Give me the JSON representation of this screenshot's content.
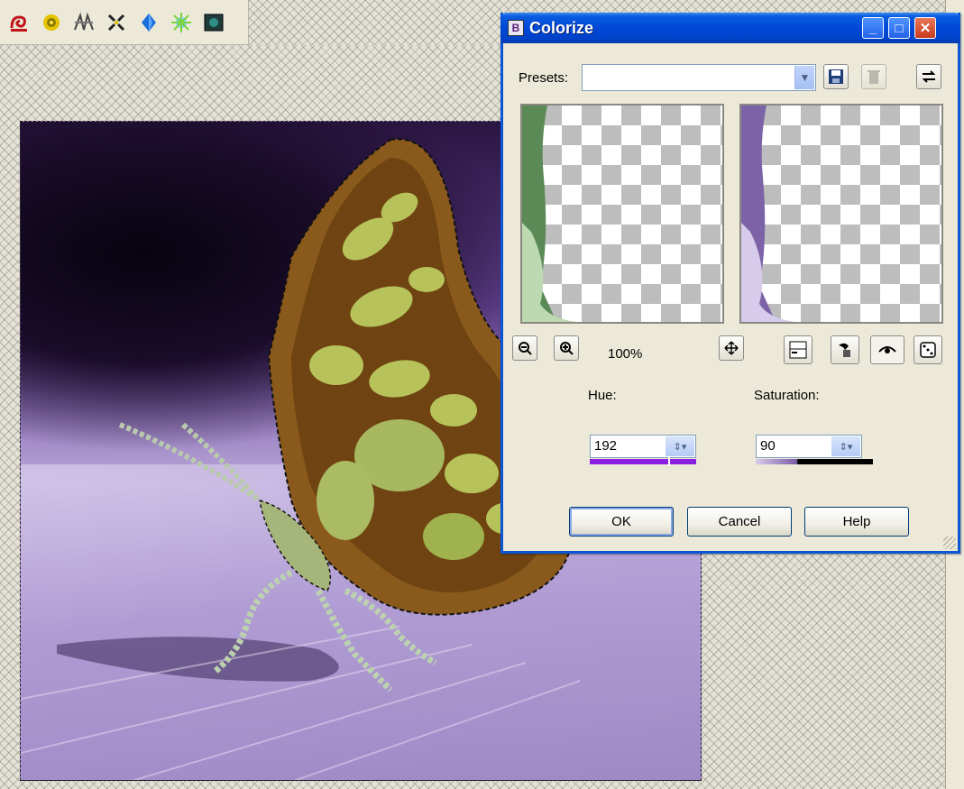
{
  "toolbar": {
    "icons": [
      "red-swirl-icon",
      "yellow-ring-icon",
      "pattern-icon",
      "sparkle-icon",
      "blue-gem-icon",
      "starburst-icon",
      "dark-frame-icon"
    ]
  },
  "dialog": {
    "title": "Colorize",
    "title_icon_letter": "B",
    "minimize_glyph": "_",
    "maximize_glyph": "□",
    "close_glyph": "✕",
    "presets_label": "Presets:",
    "presets_value": "",
    "zoom": "100%",
    "hue_label": "Hue:",
    "hue_value": "192",
    "saturation_label": "Saturation:",
    "saturation_value": "90",
    "ok_label": "OK",
    "cancel_label": "Cancel",
    "help_label": "Help"
  },
  "colors": {
    "accent": "#0a56d6",
    "hue_bar": "#8a1fe0",
    "photo_purple": "#a993cc"
  }
}
